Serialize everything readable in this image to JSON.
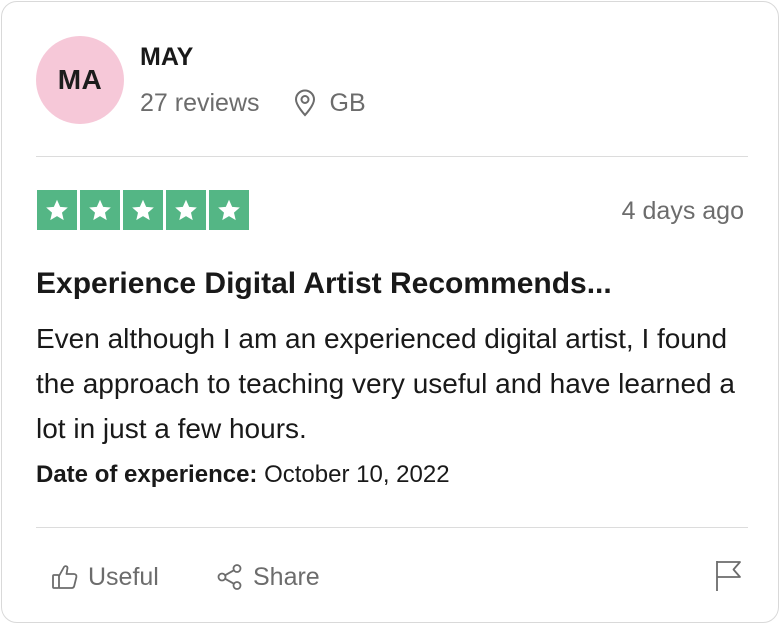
{
  "reviewer": {
    "initials": "MA",
    "name": "MAY",
    "reviews": "27 reviews",
    "country": "GB"
  },
  "rating": {
    "stars": 5,
    "max": 5,
    "posted": "4 days ago"
  },
  "review": {
    "title": "Experience Digital Artist Recommends...",
    "body": "Even although I am an experienced digital artist, I found the approach to teaching very useful and have learned a lot in just a few hours.",
    "experience_label": "Date of experience:",
    "experience_date": "October 10, 2022"
  },
  "actions": {
    "useful": "Useful",
    "share": "Share"
  },
  "colors": {
    "star_green": "#54b685",
    "avatar_pink": "#f6c8d8",
    "muted_text": "#6c6c6c"
  },
  "icons": [
    "location-pin-icon",
    "star-icon",
    "thumbs-up-icon",
    "share-icon",
    "flag-icon"
  ]
}
